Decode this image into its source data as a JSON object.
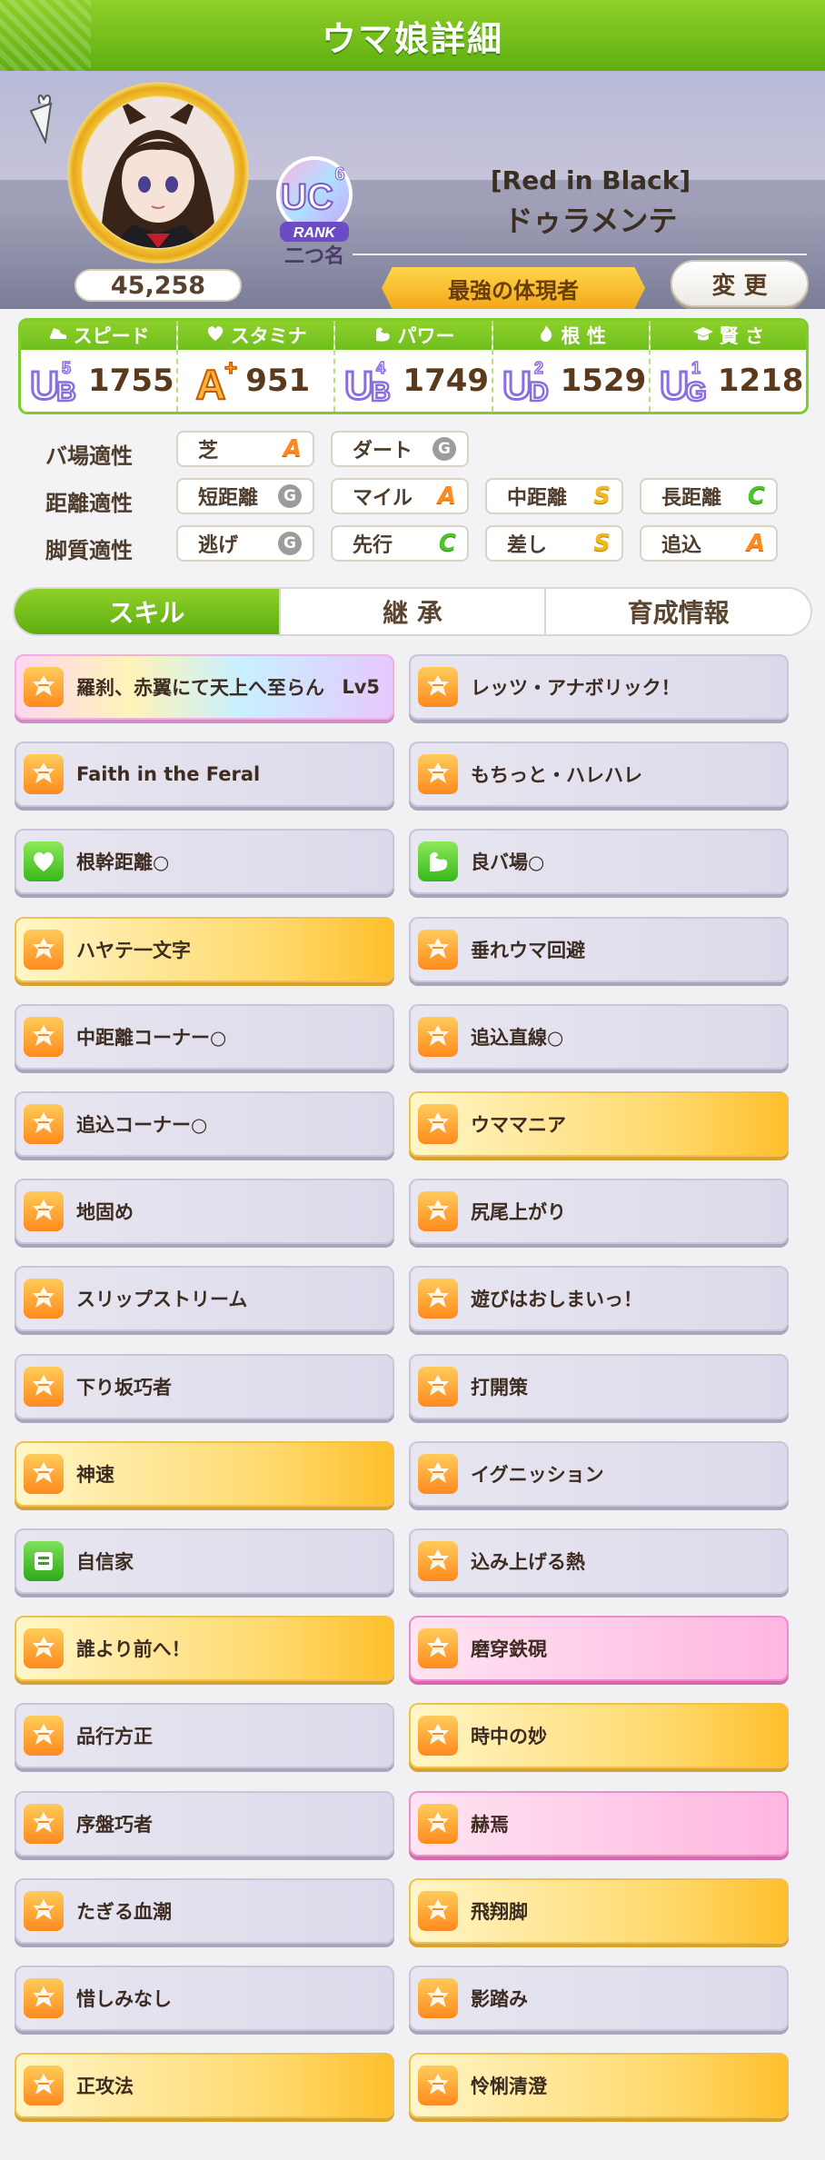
{
  "header": {
    "title": "ウマ娘詳細"
  },
  "profile": {
    "fans": "45,258",
    "rank_sub": "二つ名",
    "rank_label": "RANK",
    "rank_code": "UC",
    "rank_num": "6",
    "epithet": "[Red in Black]",
    "name": "ドゥラメンテ",
    "title": "最強の体現者",
    "change_label": "変 更",
    "memo": "－"
  },
  "stats": [
    {
      "label": "スピード",
      "grade": "UB",
      "sub": "5",
      "value": "1755",
      "icon": "shoe-icon"
    },
    {
      "label": "スタミナ",
      "grade": "A+",
      "sub": "",
      "value": "951",
      "icon": "heart-icon"
    },
    {
      "label": "パワー",
      "grade": "UB",
      "sub": "4",
      "value": "1749",
      "icon": "muscle-icon"
    },
    {
      "label": "根 性",
      "grade": "UD",
      "sub": "2",
      "value": "1529",
      "icon": "flame-icon"
    },
    {
      "label": "賢 さ",
      "grade": "UG",
      "sub": "1",
      "value": "1218",
      "icon": "graduation-cap-icon"
    }
  ],
  "aptitude": {
    "track": {
      "label": "バ場適性",
      "items": [
        {
          "name": "芝",
          "grade": "A"
        },
        {
          "name": "ダート",
          "grade": "G"
        }
      ]
    },
    "distance": {
      "label": "距離適性",
      "items": [
        {
          "name": "短距離",
          "grade": "G"
        },
        {
          "name": "マイル",
          "grade": "A"
        },
        {
          "name": "中距離",
          "grade": "S"
        },
        {
          "name": "長距離",
          "grade": "C"
        }
      ]
    },
    "strategy": {
      "label": "脚質適性",
      "items": [
        {
          "name": "逃げ",
          "grade": "G"
        },
        {
          "name": "先行",
          "grade": "C"
        },
        {
          "name": "差し",
          "grade": "S"
        },
        {
          "name": "追込",
          "grade": "A"
        }
      ]
    }
  },
  "tabs": [
    {
      "label": "スキル"
    },
    {
      "label": "継 承"
    },
    {
      "label": "育成情報"
    }
  ],
  "skills": [
    {
      "name": "羅刹、赤翼にて天上へ至らん",
      "lv": "Lv5",
      "style": "unique",
      "icon": "speed"
    },
    {
      "name": "レッツ・アナボリック！",
      "lv": "",
      "style": "normal",
      "icon": "speed"
    },
    {
      "name": "Faith in the Feral",
      "lv": "",
      "style": "normal",
      "icon": "speed"
    },
    {
      "name": "もちっと・ハレハレ",
      "lv": "",
      "style": "normal",
      "icon": "speed"
    },
    {
      "name": "根幹距離○",
      "lv": "",
      "style": "normal",
      "icon": "stamina"
    },
    {
      "name": "良バ場○",
      "lv": "",
      "style": "normal",
      "icon": "power"
    },
    {
      "name": "ハヤテ一文字",
      "lv": "",
      "style": "gold",
      "icon": "speed"
    },
    {
      "name": "垂れウマ回避",
      "lv": "",
      "style": "normal",
      "icon": "speed"
    },
    {
      "name": "中距離コーナー○",
      "lv": "",
      "style": "normal",
      "icon": "speed"
    },
    {
      "name": "追込直線○",
      "lv": "",
      "style": "normal",
      "icon": "speed"
    },
    {
      "name": "追込コーナー○",
      "lv": "",
      "style": "normal",
      "icon": "speed"
    },
    {
      "name": "ウママニア",
      "lv": "",
      "style": "gold",
      "icon": "speed"
    },
    {
      "name": "地固め",
      "lv": "",
      "style": "normal",
      "icon": "speed"
    },
    {
      "name": "尻尾上がり",
      "lv": "",
      "style": "normal",
      "icon": "speed"
    },
    {
      "name": "スリップストリーム",
      "lv": "",
      "style": "normal",
      "icon": "speed"
    },
    {
      "name": "遊びはおしまいっ！",
      "lv": "",
      "style": "normal",
      "icon": "speed"
    },
    {
      "name": "下り坂巧者",
      "lv": "",
      "style": "normal",
      "icon": "speed"
    },
    {
      "name": "打開策",
      "lv": "",
      "style": "normal",
      "icon": "speed"
    },
    {
      "name": "神速",
      "lv": "",
      "style": "gold",
      "icon": "speed"
    },
    {
      "name": "イグニッション",
      "lv": "",
      "style": "normal",
      "icon": "speed"
    },
    {
      "name": "自信家",
      "lv": "",
      "style": "normal",
      "icon": "special"
    },
    {
      "name": "込み上げる熱",
      "lv": "",
      "style": "normal",
      "icon": "speed"
    },
    {
      "name": "誰より前へ！",
      "lv": "",
      "style": "gold",
      "icon": "speed"
    },
    {
      "name": "磨穿鉄硯",
      "lv": "",
      "style": "pink",
      "icon": "speed"
    },
    {
      "name": "品行方正",
      "lv": "",
      "style": "normal",
      "icon": "speed"
    },
    {
      "name": "時中の妙",
      "lv": "",
      "style": "gold",
      "icon": "speed"
    },
    {
      "name": "序盤巧者",
      "lv": "",
      "style": "normal",
      "icon": "speed"
    },
    {
      "name": "赫焉",
      "lv": "",
      "style": "pink",
      "icon": "speed"
    },
    {
      "name": "たぎる血潮",
      "lv": "",
      "style": "normal",
      "icon": "speed"
    },
    {
      "name": "飛翔脚",
      "lv": "",
      "style": "gold",
      "icon": "speed"
    },
    {
      "name": "惜しみなし",
      "lv": "",
      "style": "normal",
      "icon": "speed"
    },
    {
      "name": "影踏み",
      "lv": "",
      "style": "normal",
      "icon": "speed"
    },
    {
      "name": "正攻法",
      "lv": "",
      "style": "gold",
      "icon": "speed"
    },
    {
      "name": "怜悧清澄",
      "lv": "",
      "style": "gold",
      "icon": "speed"
    }
  ],
  "colors": {
    "accent": "#6fbf1e",
    "gold": "#ffbf2c",
    "pink": "#ffb6e0"
  }
}
